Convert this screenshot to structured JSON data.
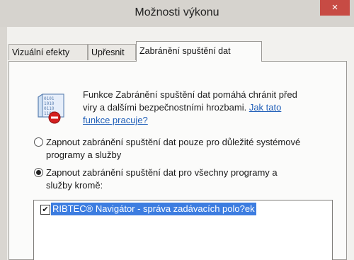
{
  "window": {
    "title": "Možnosti výkonu",
    "close_glyph": "×",
    "close_color": "#c74b44"
  },
  "tabs": [
    {
      "label": "Vizuální efekty",
      "active": false
    },
    {
      "label": "Upřesnit",
      "active": false
    },
    {
      "label": "Zabránění spuštění dat",
      "active": true
    }
  ],
  "dep": {
    "icon": "dep-shield-icon",
    "intro_line1": "Funkce Zabránění spuštění dat pomáhá chránit před",
    "intro_line2": "viry a dalšími bezpečnostními hrozbami. ",
    "help_link_line1": "Jak tato",
    "help_link_line2": "funkce pracuje?",
    "options": [
      {
        "line1": "Zapnout zabránění spuštění dat pouze pro důležité systémové",
        "line2": "programy a služby",
        "selected": false
      },
      {
        "line1": "Zapnout zabránění spuštění dat pro všechny programy a",
        "line2": "služby kromě:",
        "selected": true
      }
    ],
    "exceptions": [
      {
        "label": "RIBTEC® Navigátor - správa zadávacích polo?ek",
        "checked": true,
        "selected": true
      }
    ]
  },
  "colors": {
    "selection": "#3d7de0",
    "link": "#1f5eb8"
  }
}
